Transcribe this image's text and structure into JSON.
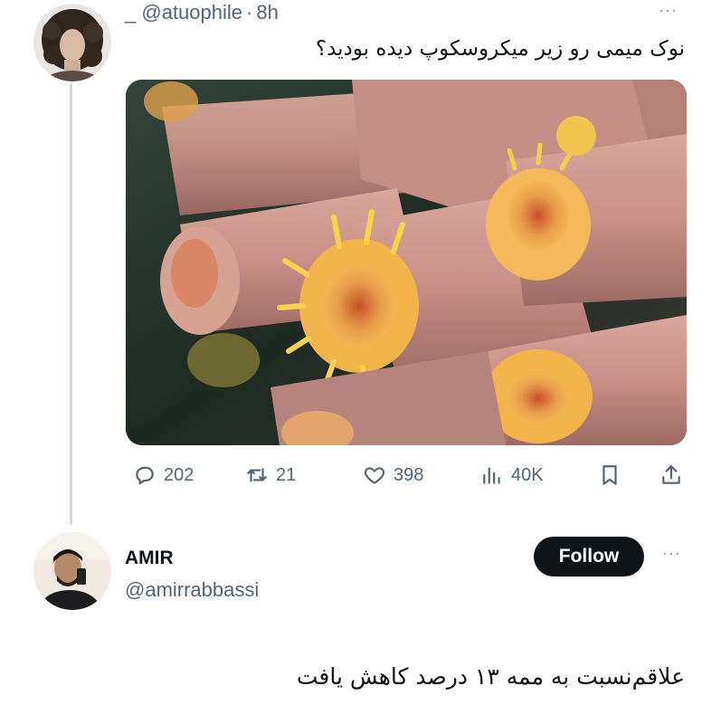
{
  "original_tweet": {
    "prefix": "_",
    "handle": "@atuophile",
    "separator": "·",
    "time": "8h",
    "more_label": "···",
    "text": "نوک میمی رو زیر میکروسکوپ دیده بودید؟",
    "media_icon": "coral-polyp-photo",
    "stats": {
      "replies": "202",
      "retweets": "21",
      "likes": "398",
      "views": "40K"
    }
  },
  "reply_tweet": {
    "name": "AMIR",
    "handle": "@amirrabbassi",
    "follow_label": "Follow",
    "more_label": "···",
    "text": "علاقم‌نسبت به ممه ۱۳ درصد کاهش یافت"
  },
  "colors": {
    "text_primary": "#0f1419",
    "text_secondary": "#536471",
    "thread_line": "#cfd9de",
    "follow_bg": "#0f1419"
  }
}
